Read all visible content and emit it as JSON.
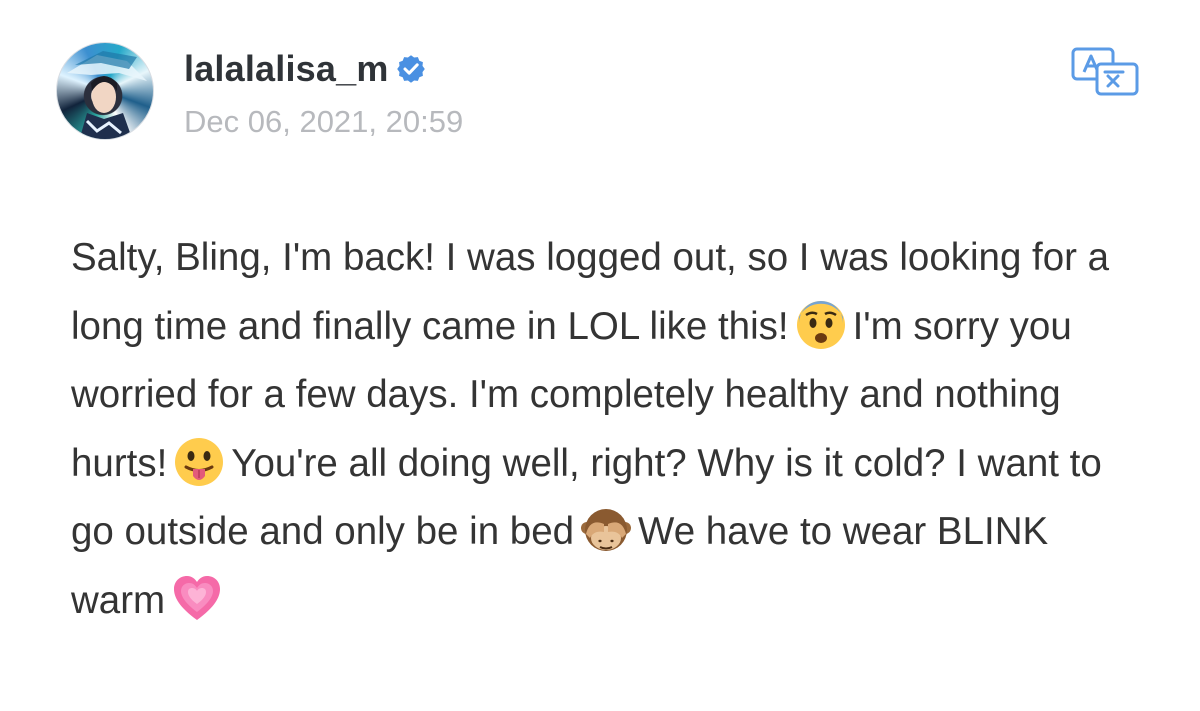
{
  "post": {
    "author": {
      "username": "lalalalisa_m",
      "verified": true
    },
    "timestamp": "Dec 06, 2021, 20:59",
    "translate_icon": "translate-icon",
    "body": {
      "segment1": "Salty, Bling, I'm back! I was logged out, so I was looking for a long time and finally came in LOL like this!",
      "emoji1": "fearful-face-emoji",
      "segment2": "I'm sorry you worried for a few days. I'm completely healthy and nothing hurts!",
      "emoji2": "face-with-tongue-emoji",
      "segment3": "You're all doing well, right? Why is it cold? I want to go outside and only be in bed",
      "emoji3": "see-no-evil-monkey-emoji",
      "segment4": "We have to wear BLINK warm",
      "emoji4": "growing-heart-emoji"
    }
  },
  "colors": {
    "verified_badge": "#4a90e2",
    "translate_icon": "#5b9be6",
    "timestamp": "#b7b9bd",
    "body_text": "#343434"
  }
}
